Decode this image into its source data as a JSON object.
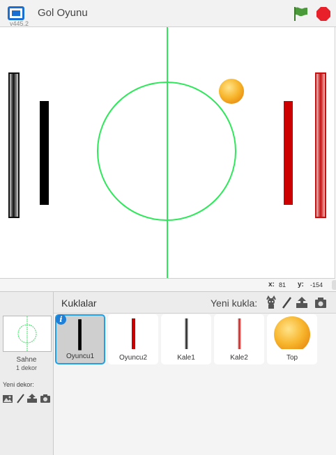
{
  "header": {
    "version": "v445.2",
    "project_title": "Gol Oyunu"
  },
  "coords": {
    "x_label": "x:",
    "x_value": "81",
    "y_label": "y:",
    "y_value": "-154"
  },
  "stage_pane": {
    "name": "Sahne",
    "backdrop_count": "1 dekor",
    "new_backdrop_label": "Yeni dekor:"
  },
  "sprites": {
    "title": "Kuklalar",
    "new_sprite_label": "Yeni kukla:",
    "items": [
      {
        "name": "Oyuncu1",
        "selected": true
      },
      {
        "name": "Oyuncu2",
        "selected": false
      },
      {
        "name": "Kale1",
        "selected": false
      },
      {
        "name": "Kale2",
        "selected": false
      },
      {
        "name": "Top",
        "selected": false
      }
    ]
  },
  "colors": {
    "accent": "#1e9fe8",
    "green_flag": "#4a9a3a",
    "stop": "#e8202a",
    "field_lines": "#2ee85a",
    "player2": "#cc0000",
    "ball": "#f5a623"
  },
  "icons": [
    "fullscreen-icon",
    "green-flag-icon",
    "stop-icon",
    "sprite-library-icon",
    "paint-icon",
    "upload-icon",
    "camera-icon",
    "info-icon"
  ]
}
